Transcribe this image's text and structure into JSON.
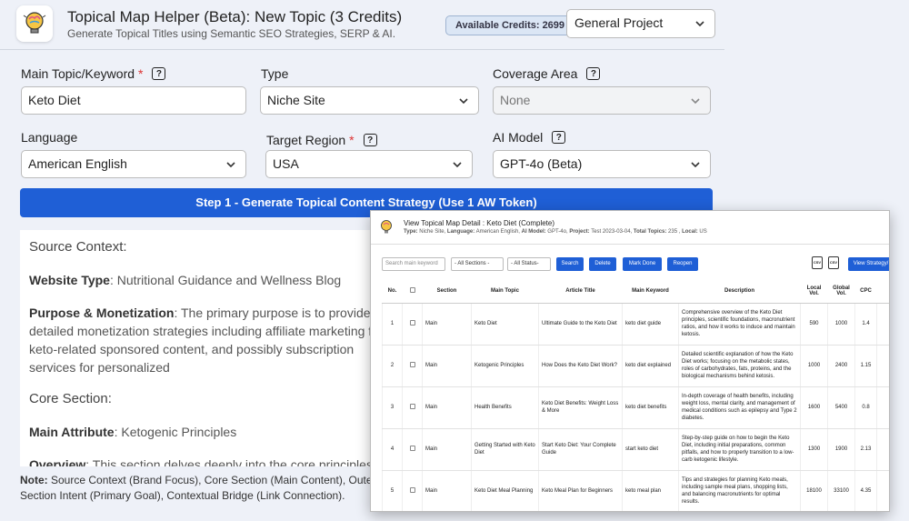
{
  "header": {
    "title": "Topical Map Helper (Beta): New Topic (3 Credits)",
    "subtitle": "Generate Topical Titles using Semantic SEO Strategies, SERP & AI.",
    "credits": "Available Credits: 2699",
    "project": "General Project"
  },
  "form": {
    "main_topic": {
      "label": "Main Topic/Keyword",
      "required": "*",
      "value": "Keto Diet"
    },
    "type": {
      "label": "Type",
      "value": "Niche Site"
    },
    "coverage": {
      "label": "Coverage Area",
      "value": "None"
    },
    "language": {
      "label": "Language",
      "value": "American English"
    },
    "region": {
      "label": "Target Region",
      "required": "*",
      "value": "USA"
    },
    "model": {
      "label": "AI Model",
      "value": "GPT-4o (Beta)"
    },
    "help": "?"
  },
  "step_button": "Step 1 - Generate Topical Content Strategy (Use 1 AW Token)",
  "strategy": {
    "source_heading": "Source Context:",
    "website_type_label": "Website Type",
    "website_type": ": Nutritional Guidance and Wellness Blog",
    "purpose_label": "Purpose & Monetization",
    "purpose": ": The primary purpose is to provide detailed monetization strategies including affiliate marketing for keto-related sponsored content, and possibly subscription services for personalized",
    "core_heading": "Core Section:",
    "main_attr_label": "Main Attribute",
    "main_attr": ": Ketogenic Principles",
    "overview_label": "Overview",
    "overview": ": This section delves deeply into the core principles and alters metabolism, the role of ketones, and how ketosis is achieved"
  },
  "note": {
    "label": "Note:",
    "text": " Source Context (Brand Focus), Core Section (Main Content), Outer Section Intent (Primary Goal), Contextual Bridge (Link Connection)."
  },
  "overlay": {
    "title": "View Topical Map Detail : Keto Diet (Complete)",
    "meta": {
      "type_label": "Type:",
      "type": " Niche Site, ",
      "language_label": "Language:",
      "language": " American English, ",
      "model_label": "AI Model:",
      "model": " GPT-4o, ",
      "project_label": "Project:",
      "project": " Test 2023-03-04, ",
      "topics_label": "Total Topics:",
      "topics": " 235 , ",
      "local_label": "Local:",
      "local": " US"
    },
    "search_placeholder": "Search main keyword",
    "sections_filter": "- All Sections -",
    "status_filter": "- All Status-",
    "buttons": {
      "search": "Search",
      "delete": "Delete",
      "mark_done": "Mark Done",
      "reopen": "Reopen",
      "view_strategy": "View Strategy/"
    },
    "export_icons": [
      "CSV",
      "CSV"
    ],
    "columns": [
      "No.",
      "",
      "Section",
      "Main Topic",
      "Article Title",
      "Main Keyword",
      "Description",
      "Local Vol.",
      "Global Vol.",
      "CPC"
    ],
    "rows": [
      {
        "no": "1",
        "section": "Main",
        "topic": "Keto Diet",
        "title": "Ultimate Guide to the Keto Diet",
        "keyword": "keto diet guide",
        "description": "Comprehensive overview of the Keto Diet principles, scientific foundations, macronutrient ratios, and how it works to induce and maintain ketosis.",
        "local": "590",
        "global": "1000",
        "cpc": "1.4"
      },
      {
        "no": "2",
        "section": "Main",
        "topic": "Ketogenic Principles",
        "title": "How Does the Keto Diet Work?",
        "keyword": "keto diet explained",
        "description": "Detailed scientific explanation of how the Keto Diet works; focusing on the metabolic states, roles of carbohydrates, fats, proteins, and the biological mechanisms behind ketosis.",
        "local": "1000",
        "global": "2400",
        "cpc": "1.15"
      },
      {
        "no": "3",
        "section": "Main",
        "topic": "Health Benefits",
        "title": "Keto Diet Benefits: Weight Loss & More",
        "keyword": "keto diet benefits",
        "description": "In-depth coverage of health benefits, including weight loss, mental clarity, and management of medical conditions such as epilepsy and Type 2 diabetes.",
        "local": "1600",
        "global": "5400",
        "cpc": "0.8"
      },
      {
        "no": "4",
        "section": "Main",
        "topic": "Getting Started with Keto Diet",
        "title": "Start Keto Diet: Your Complete Guide",
        "keyword": "start keto diet",
        "description": "Step-by-step guide on how to begin the Keto Diet, including initial preparations, common pitfalls, and how to properly transition to a low-carb ketogenic lifestyle.",
        "local": "1300",
        "global": "1900",
        "cpc": "2.13"
      },
      {
        "no": "5",
        "section": "Main",
        "topic": "Keto Diet Meal Planning",
        "title": "Keto Meal Plan for Beginners",
        "keyword": "keto meal plan",
        "description": "Tips and strategies for planning Keto meals, including sample meal plans, shopping lists, and balancing macronutrients for optimal results.",
        "local": "18100",
        "global": "33100",
        "cpc": "4.35"
      }
    ]
  }
}
